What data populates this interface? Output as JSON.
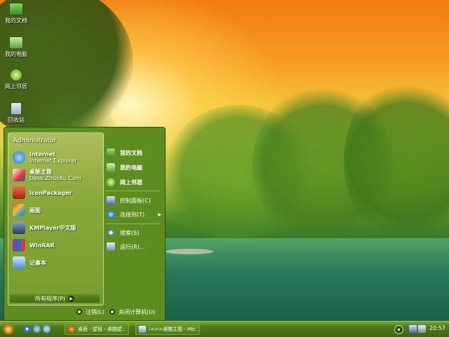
{
  "desktop": {
    "icons": [
      {
        "label": "我的文档",
        "icon": "folder-documents-icon"
      },
      {
        "label": "我的电脑",
        "icon": "my-computer-icon"
      },
      {
        "label": "网上邻居",
        "icon": "network-icon"
      },
      {
        "label": "回收站",
        "icon": "recycle-bin-icon"
      }
    ]
  },
  "start_menu": {
    "user": "Administrator",
    "pinned": [
      {
        "title": "Internet",
        "subtitle": "Internet Explorer",
        "icon": "internet-explorer-icon"
      },
      {
        "title": "桌酷主题",
        "subtitle": "Desk.ZhuoKu.Com",
        "icon": "zhuoku-theme-icon"
      },
      {
        "title": "IconPackager",
        "subtitle": "",
        "icon": "iconpackager-icon"
      },
      {
        "title": "画图",
        "subtitle": "",
        "icon": "paint-icon"
      },
      {
        "title": "KMPlayer中文版",
        "subtitle": "",
        "icon": "kmplayer-icon"
      },
      {
        "title": "WinRAR",
        "subtitle": "",
        "icon": "winrar-icon"
      },
      {
        "title": "记事本",
        "subtitle": "",
        "icon": "notepad-icon"
      }
    ],
    "all_programs": "所有程序(P)",
    "right": [
      {
        "label": "我的文档",
        "icon": "folder-documents-icon",
        "bold": true
      },
      {
        "label": "我的电脑",
        "icon": "my-computer-icon",
        "bold": true
      },
      {
        "label": "网上邻居",
        "icon": "network-icon",
        "bold": true
      },
      {
        "label": "控制面板(C)",
        "icon": "control-panel-icon",
        "bold": false
      },
      {
        "label": "连接到(T)",
        "icon": "connect-to-icon",
        "bold": false,
        "arrow": "▶"
      },
      {
        "label": "搜索(S)",
        "icon": "search-icon",
        "bold": false
      },
      {
        "label": "运行(R)...",
        "icon": "run-icon",
        "bold": false
      }
    ],
    "logoff": "注销(L)",
    "shutdown": "关闭计算机(U)"
  },
  "taskbar": {
    "quick_launch": [
      "desktop-show-icon",
      "ie-quick-launch-icon",
      "ie-quick-launch-icon-2"
    ],
    "tasks": [
      {
        "label": "桌面 - 壁纸 - 桌酷壁...",
        "icon": "browser-icon"
      },
      {
        "label": "-=>>桌酷主题 - Mic...",
        "icon": "document-icon"
      }
    ],
    "clock": "20:57"
  },
  "colors": {
    "start_menu_bg": "#5e8d1f",
    "taskbar": "#4f7a1c"
  }
}
